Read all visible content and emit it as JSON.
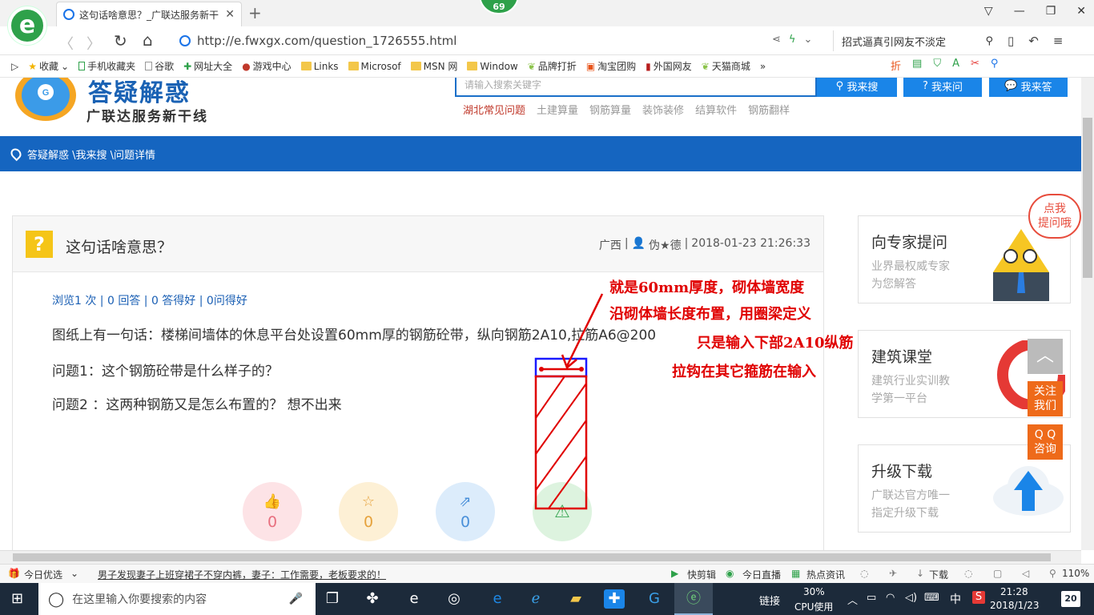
{
  "browser": {
    "tab_title": "这句话啥意思？_广联达服务新干",
    "badge": "69",
    "url": "http://e.fwxgx.com/question_1726555.html",
    "search_text": "招式逼真引网友不淡定",
    "bookmarks": [
      "收藏",
      "手机收藏夹",
      "谷歌",
      "网址大全",
      "游戏中心",
      "Links",
      "Microsof",
      "MSN 网",
      "Window",
      "品牌打折",
      "淘宝团购",
      "外国网友",
      "天猫商城"
    ]
  },
  "site": {
    "title": "答疑解惑",
    "slogan": "广联达服务新干线",
    "search_placeholder": "请输入搜索关键字",
    "btn_search": "我来搜",
    "btn_ask": "我来问",
    "btn_answer": "我来答",
    "nav": [
      "湖北常见问题",
      "土建算量",
      "钢筋算量",
      "装饰装修",
      "结算软件",
      "钢筋翻样"
    ],
    "breadcrumb": "答疑解惑 \\我来搜 \\问题详情"
  },
  "question": {
    "title": "这句话啥意思？",
    "region": "广西",
    "user": "伪★德",
    "datetime": "2018-01-23 21:26:33",
    "stats": "浏览1 次 | 0 回答 | 0 答得好 | 0问得好",
    "line1": "图纸上有一句话：楼梯间墙体的休息平台处设置60mm厚的钢筋砼带，纵向钢筋2A10,拉筋A6@200",
    "line2": "问题1：这个钢筋砼带是什么样子的？",
    "line3": "问题2 ：这两种钢筋又是怎么布置的？  想不出来",
    "likes": "0",
    "favorites": "0",
    "shares": "0"
  },
  "annotations": {
    "a1": "就是60mm厚度，砌体墙宽度",
    "a2": "沿砌体墙长度布置，用圈梁定义",
    "a3": "只是输入下部2A10纵筋",
    "a4": "拉钩在其它箍筋在输入"
  },
  "sidebar": {
    "bubble": "点我\n提问哦",
    "expert_title": "向专家提问",
    "expert_desc": "业界最权威专家\n为您解答",
    "course_title": "建筑课堂",
    "course_desc": "建筑行业实训教\n学第一平台",
    "download_title": "升级下载",
    "download_desc": "广联达官方唯一\n指定升级下载",
    "follow": "关注\n我们",
    "qq": "Q Q\n咨询"
  },
  "statusbar": {
    "left_label": "今日优选",
    "news": "男子发现妻子上班穿裙子不穿内裤，妻子：工作需要，老板要求的！",
    "items": [
      "快剪辑",
      "今日直播",
      "热点资讯",
      "下载"
    ],
    "zoom": "110%"
  },
  "taskbar": {
    "search_placeholder": "在这里输入你要搜索的内容",
    "link_label": "链接",
    "cpu_percent": "30%",
    "cpu_label": "CPU使用",
    "ime": "中",
    "time": "21:28",
    "date": "2018/1/23",
    "notif": "20"
  },
  "colors": {
    "brand_blue": "#1565c0",
    "annotation_red": "#e00000",
    "accent_orange": "#ee6a1a"
  }
}
